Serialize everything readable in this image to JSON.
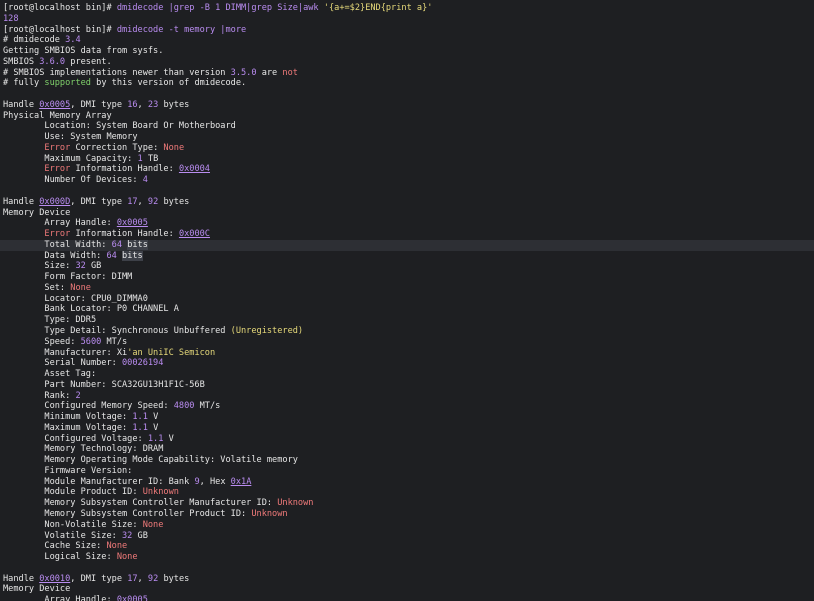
{
  "highlight_line": 22,
  "lines": [
    [
      [
        "t",
        "[root@localhost bin]# "
      ],
      [
        "c",
        "dmidecode |grep -B 1 DIMM|grep Size|awk "
      ],
      [
        "y",
        "'{a+=$2}END{print a}'"
      ]
    ],
    [
      [
        "c",
        "128"
      ]
    ],
    [
      [
        "t",
        "[root@localhost bin]# "
      ],
      [
        "c",
        "dmidecode -t memory |more"
      ]
    ],
    [
      [
        "t",
        "# dmidecode "
      ],
      [
        "n",
        "3.4"
      ]
    ],
    [
      [
        "t",
        "Getting SMBIOS data from sysfs."
      ]
    ],
    [
      [
        "t",
        "SMBIOS "
      ],
      [
        "n",
        "3.6.0"
      ],
      [
        "t",
        " present."
      ]
    ],
    [
      [
        "t",
        "# SMBIOS implementations newer than version "
      ],
      [
        "n",
        "3.5.0"
      ],
      [
        "t",
        " are "
      ],
      [
        "r",
        "not"
      ]
    ],
    [
      [
        "t",
        "# fully "
      ],
      [
        "g",
        "supported"
      ],
      [
        "t",
        " by this version of dmidecode."
      ]
    ],
    [
      [
        "t",
        ""
      ]
    ],
    [
      [
        "t",
        "Handle "
      ],
      [
        "l",
        "0x0005"
      ],
      [
        "t",
        ", DMI type "
      ],
      [
        "n",
        "16"
      ],
      [
        "t",
        ", "
      ],
      [
        "n",
        "23"
      ],
      [
        "t",
        " bytes"
      ]
    ],
    [
      [
        "t",
        "Physical Memory Array"
      ]
    ],
    [
      [
        "t",
        "        Location: System Board Or Motherboard"
      ]
    ],
    [
      [
        "t",
        "        Use: System Memory"
      ]
    ],
    [
      [
        "t",
        "        "
      ],
      [
        "r",
        "Error"
      ],
      [
        "t",
        " Correction Type: "
      ],
      [
        "r",
        "None"
      ]
    ],
    [
      [
        "t",
        "        Maximum Capacity: "
      ],
      [
        "n",
        "1"
      ],
      [
        "t",
        " TB"
      ]
    ],
    [
      [
        "t",
        "        "
      ],
      [
        "r",
        "Error"
      ],
      [
        "t",
        " Information Handle: "
      ],
      [
        "l",
        "0x0004"
      ]
    ],
    [
      [
        "t",
        "        Number Of Devices: "
      ],
      [
        "n",
        "4"
      ]
    ],
    [
      [
        "t",
        ""
      ]
    ],
    [
      [
        "t",
        "Handle "
      ],
      [
        "l",
        "0x000D"
      ],
      [
        "t",
        ", DMI type "
      ],
      [
        "n",
        "17"
      ],
      [
        "t",
        ", "
      ],
      [
        "n",
        "92"
      ],
      [
        "t",
        " bytes"
      ]
    ],
    [
      [
        "t",
        "Memory Device"
      ]
    ],
    [
      [
        "t",
        "        Array Handle: "
      ],
      [
        "l",
        "0x0005"
      ]
    ],
    [
      [
        "t",
        "        "
      ],
      [
        "r",
        "Error"
      ],
      [
        "t",
        " Information Handle: "
      ],
      [
        "l",
        "0x000C"
      ]
    ],
    [
      [
        "t",
        "        Total Width: "
      ],
      [
        "n",
        "64"
      ],
      [
        "t",
        " "
      ],
      [
        "s",
        "bits"
      ]
    ],
    [
      [
        "t",
        "        Data Width: "
      ],
      [
        "n",
        "64"
      ],
      [
        "t",
        " "
      ],
      [
        "s",
        "bits"
      ]
    ],
    [
      [
        "t",
        "        Size: "
      ],
      [
        "n",
        "32"
      ],
      [
        "t",
        " GB"
      ]
    ],
    [
      [
        "t",
        "        Form Factor: DIMM"
      ]
    ],
    [
      [
        "t",
        "        Set: "
      ],
      [
        "r",
        "None"
      ]
    ],
    [
      [
        "t",
        "        Locator: CPU0_DIMMA0"
      ]
    ],
    [
      [
        "t",
        "        Bank Locator: P0 CHANNEL A"
      ]
    ],
    [
      [
        "t",
        "        Type: DDR5"
      ]
    ],
    [
      [
        "t",
        "        Type Detail: Synchronous Unbuffered "
      ],
      [
        "y",
        "(Unregistered)"
      ]
    ],
    [
      [
        "t",
        "        Speed: "
      ],
      [
        "n",
        "5600"
      ],
      [
        "t",
        " MT/s"
      ]
    ],
    [
      [
        "t",
        "        Manufacturer: Xi"
      ],
      [
        "y",
        "'an UniIC Semicon"
      ]
    ],
    [
      [
        "t",
        "        Serial Number: "
      ],
      [
        "n",
        "00026194"
      ]
    ],
    [
      [
        "t",
        "        Asset Tag:"
      ]
    ],
    [
      [
        "t",
        "        Part Number: SCA32GU13H1F1C-56B"
      ]
    ],
    [
      [
        "t",
        "        Rank: "
      ],
      [
        "n",
        "2"
      ]
    ],
    [
      [
        "t",
        "        Configured Memory Speed: "
      ],
      [
        "n",
        "4800"
      ],
      [
        "t",
        " MT/s"
      ]
    ],
    [
      [
        "t",
        "        Minimum Voltage: "
      ],
      [
        "n",
        "1.1"
      ],
      [
        "t",
        " V"
      ]
    ],
    [
      [
        "t",
        "        Maximum Voltage: "
      ],
      [
        "n",
        "1.1"
      ],
      [
        "t",
        " V"
      ]
    ],
    [
      [
        "t",
        "        Configured Voltage: "
      ],
      [
        "n",
        "1.1"
      ],
      [
        "t",
        " V"
      ]
    ],
    [
      [
        "t",
        "        Memory Technology: DRAM"
      ]
    ],
    [
      [
        "t",
        "        Memory Operating Mode Capability: Volatile memory"
      ]
    ],
    [
      [
        "t",
        "        Firmware Version:"
      ]
    ],
    [
      [
        "t",
        "        Module Manufacturer ID: Bank "
      ],
      [
        "n",
        "9"
      ],
      [
        "t",
        ", Hex "
      ],
      [
        "l",
        "0x1A"
      ]
    ],
    [
      [
        "t",
        "        Module Product ID: "
      ],
      [
        "r",
        "Unknown"
      ]
    ],
    [
      [
        "t",
        "        Memory Subsystem Controller Manufacturer ID: "
      ],
      [
        "r",
        "Unknown"
      ]
    ],
    [
      [
        "t",
        "        Memory Subsystem Controller Product ID: "
      ],
      [
        "r",
        "Unknown"
      ]
    ],
    [
      [
        "t",
        "        Non-Volatile Size: "
      ],
      [
        "r",
        "None"
      ]
    ],
    [
      [
        "t",
        "        Volatile Size: "
      ],
      [
        "n",
        "32"
      ],
      [
        "t",
        " GB"
      ]
    ],
    [
      [
        "t",
        "        Cache Size: "
      ],
      [
        "r",
        "None"
      ]
    ],
    [
      [
        "t",
        "        Logical Size: "
      ],
      [
        "r",
        "None"
      ]
    ],
    [
      [
        "t",
        ""
      ]
    ],
    [
      [
        "t",
        "Handle "
      ],
      [
        "l",
        "0x0010"
      ],
      [
        "t",
        ", DMI type "
      ],
      [
        "n",
        "17"
      ],
      [
        "t",
        ", "
      ],
      [
        "n",
        "92"
      ],
      [
        "t",
        " bytes"
      ]
    ],
    [
      [
        "t",
        "Memory Device"
      ]
    ],
    [
      [
        "t",
        "        Array Handle: "
      ],
      [
        "l",
        "0x0005"
      ]
    ]
  ]
}
